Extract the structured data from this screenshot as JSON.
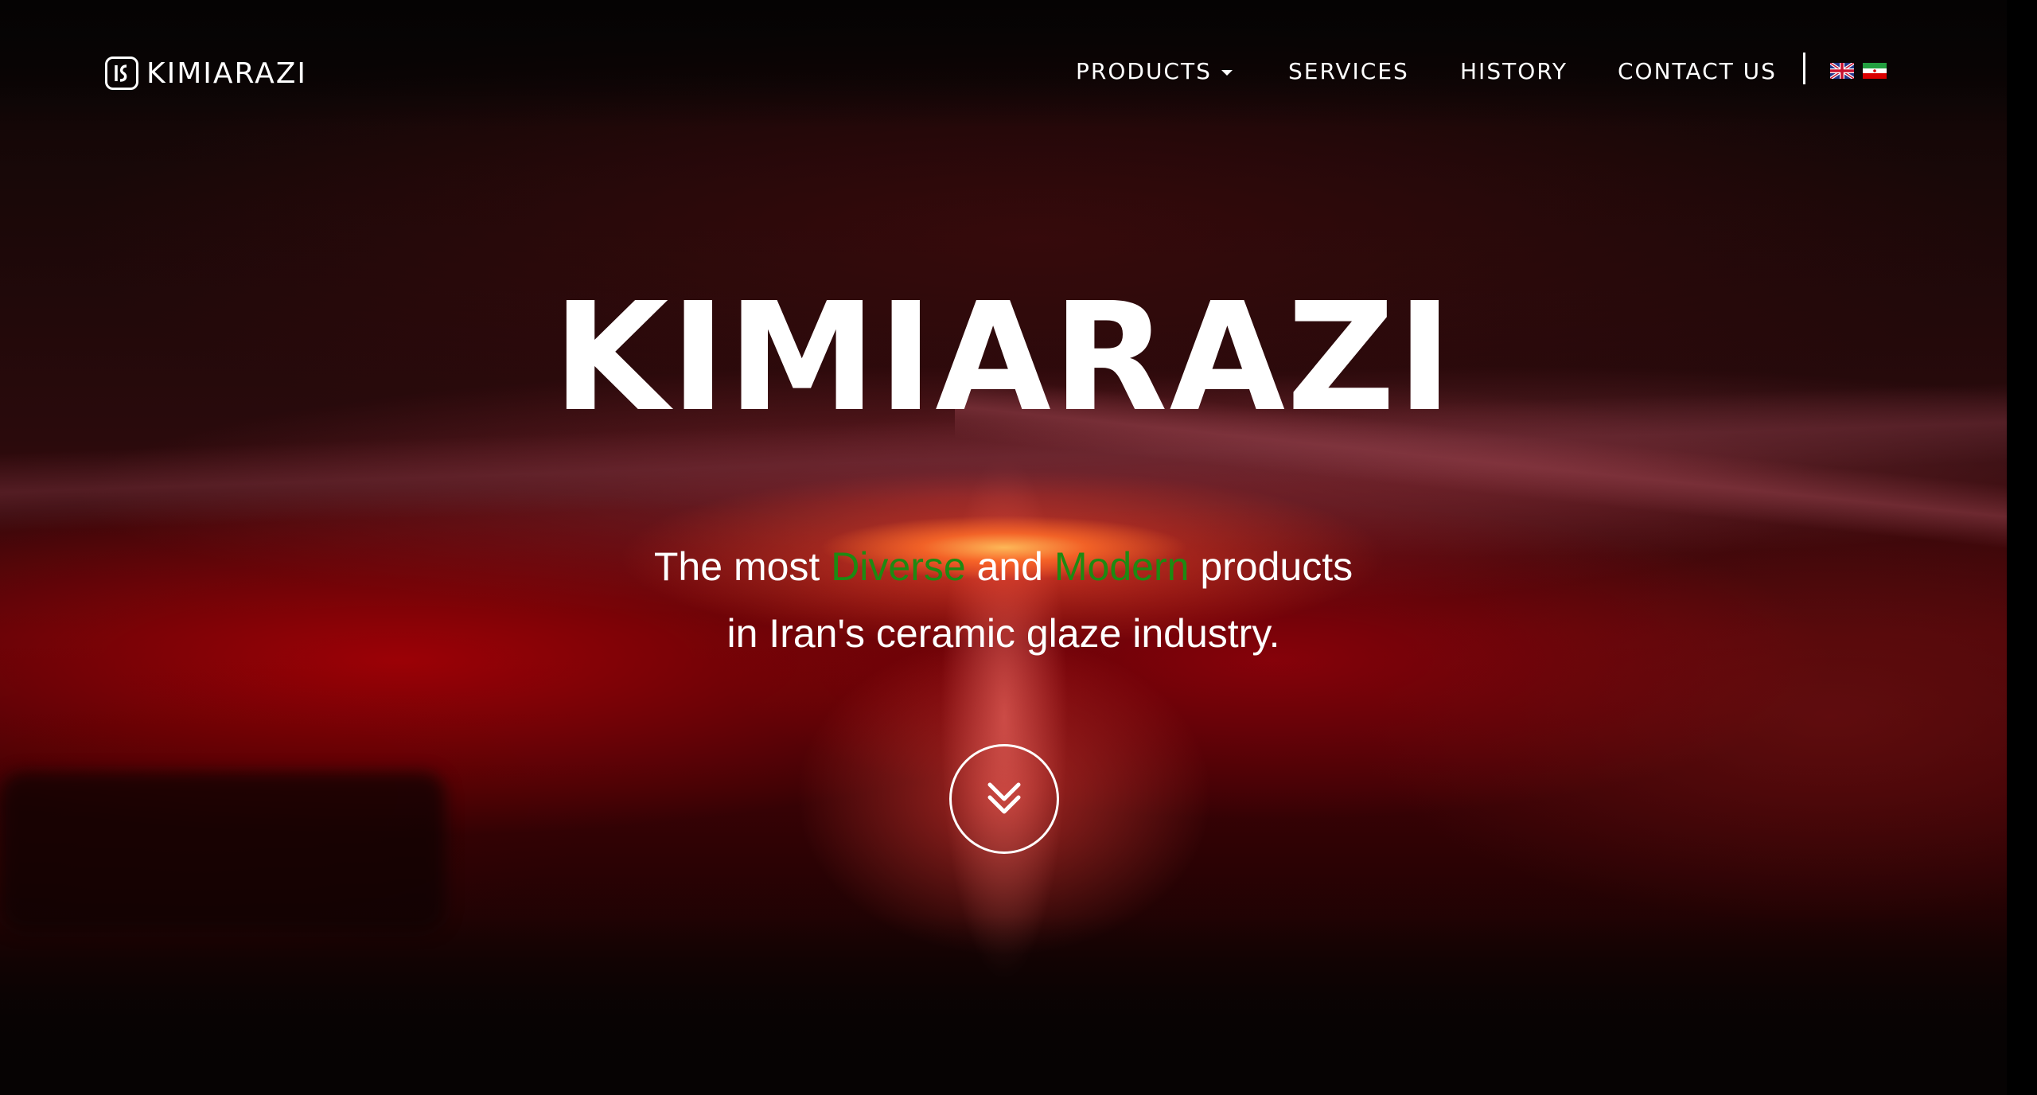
{
  "brand": {
    "name": "KIMIARAZI",
    "logo_icon": "kimiarazi-logo-icon"
  },
  "nav": {
    "items": [
      {
        "label": "PRODUCTS",
        "has_dropdown": true
      },
      {
        "label": "SERVICES",
        "has_dropdown": false
      },
      {
        "label": "HISTORY",
        "has_dropdown": false
      },
      {
        "label": "CONTACT US",
        "has_dropdown": false
      }
    ],
    "languages": [
      {
        "icon": "uk-flag-icon"
      },
      {
        "icon": "iran-flag-icon"
      }
    ]
  },
  "hero": {
    "title": "KIMIARAZI",
    "subtitle": {
      "line1_part1": "The most ",
      "line1_highlight1": "Diverse",
      "line1_part2": " and ",
      "line1_highlight2": "Modern",
      "line1_part3": " products",
      "line2": "in Iran's ceramic glaze industry."
    },
    "scroll_icon": "double-chevron-down-icon"
  },
  "colors": {
    "highlight": "#1d8a12",
    "text": "#ffffff",
    "background": "#060303"
  }
}
